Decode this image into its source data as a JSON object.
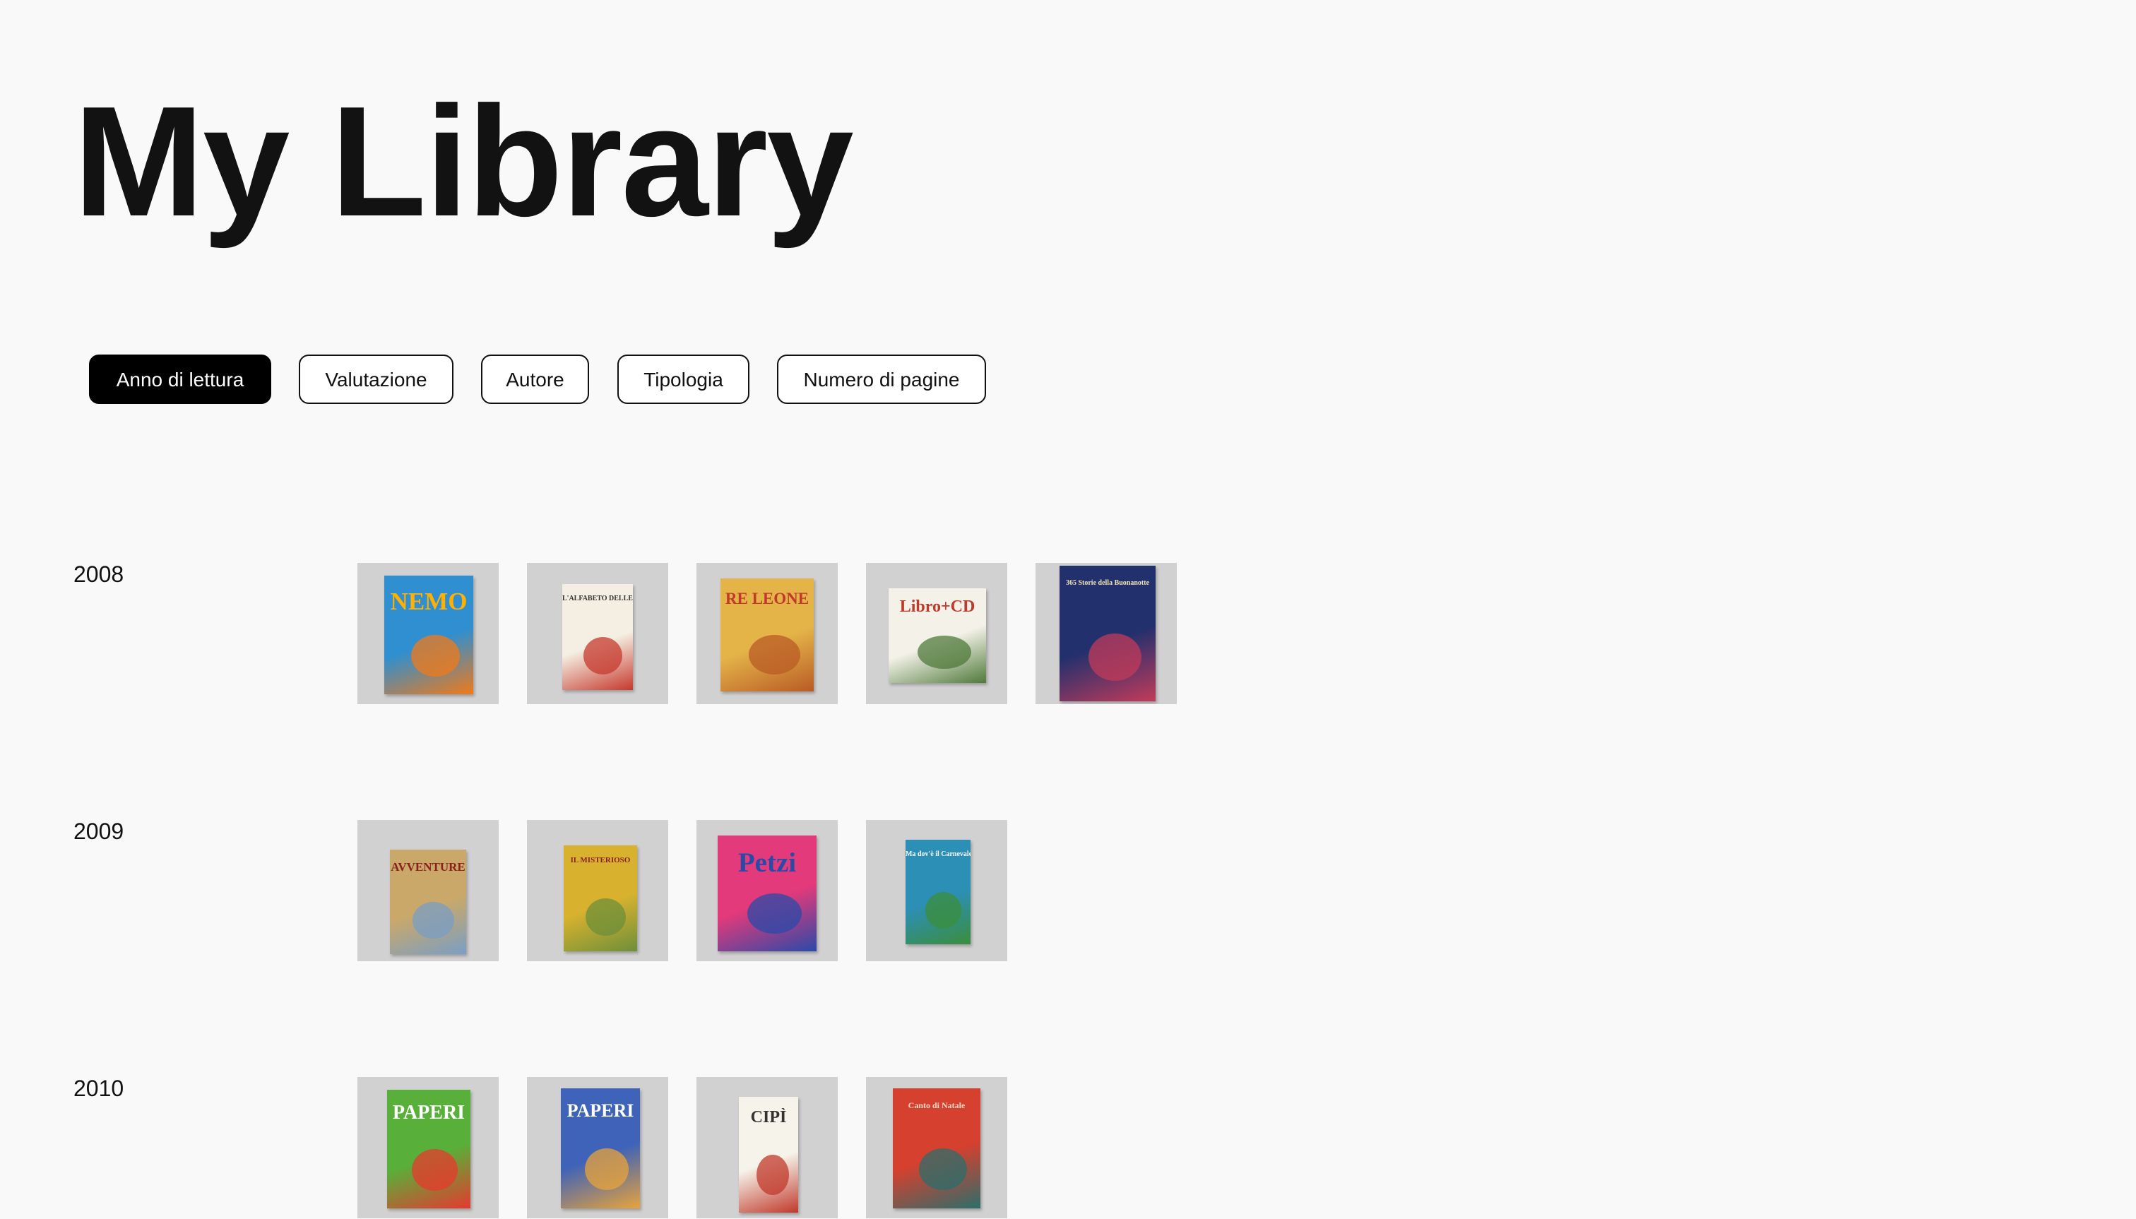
{
  "page_title": "My Library",
  "filters": [
    {
      "label": "Anno di lettura",
      "active": true
    },
    {
      "label": "Valutazione",
      "active": false
    },
    {
      "label": "Autore",
      "active": false
    },
    {
      "label": "Tipologia",
      "active": false
    },
    {
      "label": "Numero di pagine",
      "active": false
    }
  ],
  "years": [
    {
      "year": "2008",
      "books": [
        {
          "cover_text": "NEMO",
          "cover_color": "#2f8fd0",
          "accent_color": "#f07a1a",
          "text_color": "#ffb000"
        },
        {
          "cover_text": "L'ALFABETO DELLE FIABE",
          "cover_color": "#f4efe2",
          "accent_color": "#c6392e",
          "text_color": "#333333"
        },
        {
          "cover_text": "RE LEONE",
          "cover_color": "#e4b449",
          "accent_color": "#b95b25",
          "text_color": "#c0392b"
        },
        {
          "cover_text": "Libro+CD",
          "cover_color": "#f3f1e8",
          "accent_color": "#4f7a3a",
          "text_color": "#c0392b"
        },
        {
          "cover_text": "365 Storie della Buonanotte",
          "cover_color": "#22306e",
          "accent_color": "#c23b5a",
          "text_color": "#f2e3b0"
        }
      ]
    },
    {
      "year": "2009",
      "books": [
        {
          "cover_text": "AVVENTURE",
          "cover_color": "#c9a86a",
          "accent_color": "#7a9ec4",
          "text_color": "#8b1e1e"
        },
        {
          "cover_text": "IL MISTERIOSO",
          "cover_color": "#d8b22e",
          "accent_color": "#6e8f3a",
          "text_color": "#8b1e1e"
        },
        {
          "cover_text": "Petzi",
          "cover_color": "#e23a7a",
          "accent_color": "#2a4aa8",
          "text_color": "#2a4aa8"
        },
        {
          "cover_text": "Ma dov'è il Carnevale?",
          "cover_color": "#2c8fb6",
          "accent_color": "#3b8e3b",
          "text_color": "#ffffff"
        }
      ]
    },
    {
      "year": "2010",
      "books": [
        {
          "cover_text": "PAPERI",
          "cover_color": "#58b03a",
          "accent_color": "#e53a2e",
          "text_color": "#ffffff"
        },
        {
          "cover_text": "PAPERI",
          "cover_color": "#3e63b8",
          "accent_color": "#e8a33b",
          "text_color": "#ffffff"
        },
        {
          "cover_text": "CIPÌ",
          "cover_color": "#f6f3ea",
          "accent_color": "#c0392b",
          "text_color": "#333333"
        },
        {
          "cover_text": "Canto di Natale",
          "cover_color": "#d5402f",
          "accent_color": "#2c6e6a",
          "text_color": "#f7d9c9"
        }
      ]
    }
  ]
}
